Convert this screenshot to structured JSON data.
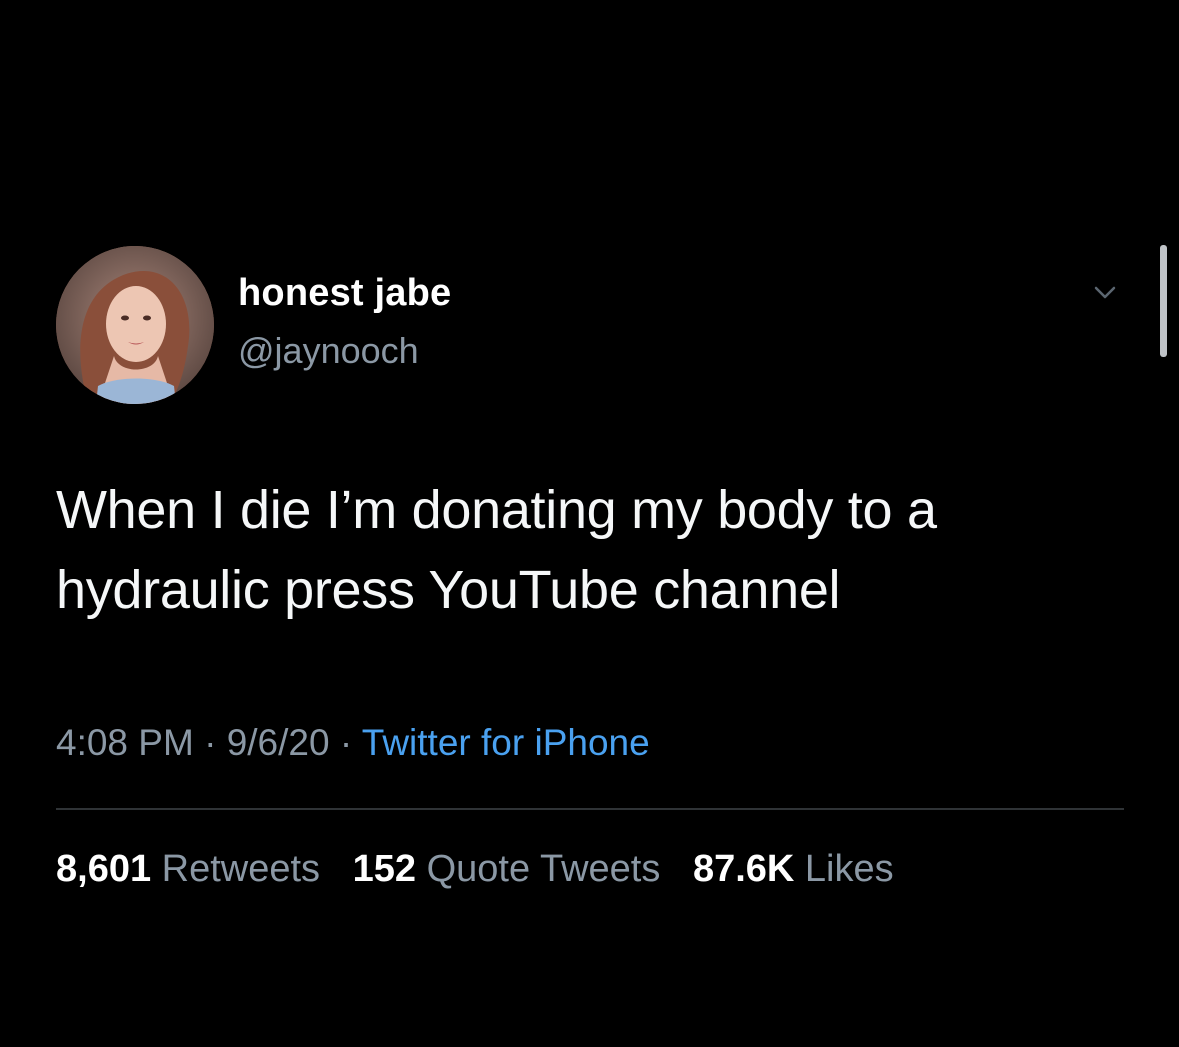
{
  "user": {
    "display_name": "honest jabe",
    "handle": "@jaynooch"
  },
  "tweet": {
    "text_line1": "When I die I’m donating my body to a",
    "text_line2": "hydraulic press YouTube channel",
    "time": "4:08 PM",
    "date": "9/6/20",
    "separator": " · ",
    "source": "Twitter for iPhone"
  },
  "stats": {
    "retweets_count": "8,601",
    "retweets_label": "Retweets",
    "quotes_count": "152",
    "quotes_label": "Quote Tweets",
    "likes_count": "87.6K",
    "likes_label": "Likes"
  },
  "icons": {
    "caret": "chevron-down-icon"
  },
  "colors": {
    "background": "#000000",
    "primary_text": "#ffffff",
    "secondary_text": "#8b98a5",
    "link": "#4aa1f0",
    "divider": "#2f3336"
  }
}
